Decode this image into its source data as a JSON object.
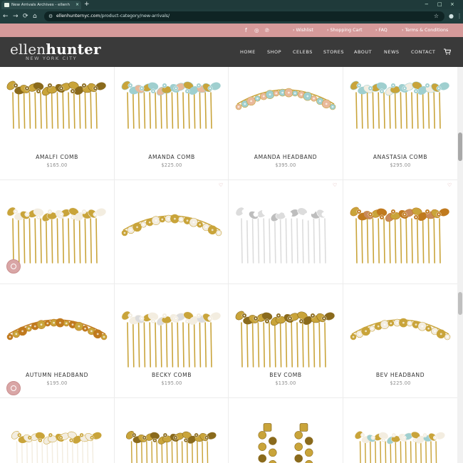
{
  "browser": {
    "tab_title": "New Arrivals Archives - ellenh",
    "tab_close": "×",
    "new_tab": "+",
    "url_domain": "ellenhunternyc.com",
    "url_path": "/product-category/new-arrivals/",
    "nav": {
      "back": "←",
      "forward": "→",
      "reload": "⟳",
      "home": "⌂"
    },
    "star": "☆",
    "account": "●",
    "menu": "⋮",
    "window_controls": {
      "minimize": "−",
      "maximize": "□",
      "close": "×"
    }
  },
  "topbar": {
    "social": {
      "facebook": "f",
      "instagram": "◎",
      "pinterest": "℗"
    },
    "links": [
      "› Wishlist",
      "› Shopping Cart",
      "› FAQ",
      "› Terms & Conditions"
    ]
  },
  "header": {
    "logo_light": "ellen",
    "logo_bold": "hunter",
    "logo_sub": "NEW YORK CITY",
    "nav": [
      "HOME",
      "SHOP",
      "CELEBS",
      "STORES",
      "ABOUT",
      "NEWS",
      "CONTACT"
    ]
  },
  "products": [
    {
      "name": "AMALFI COMB",
      "price": "$165.00",
      "type": "comb"
    },
    {
      "name": "AMANDA COMB",
      "price": "$225.00",
      "type": "comb"
    },
    {
      "name": "AMANDA HEADBAND",
      "price": "$395.00",
      "type": "headband"
    },
    {
      "name": "ANASTASIA COMB",
      "price": "$295.00",
      "type": "comb"
    },
    {
      "name": "",
      "price": "",
      "type": "comb"
    },
    {
      "name": "",
      "price": "",
      "type": "headband"
    },
    {
      "name": "",
      "price": "",
      "type": "comb"
    },
    {
      "name": "",
      "price": "",
      "type": "comb"
    },
    {
      "name": "AUTUMN HEADBAND",
      "price": "$195.00",
      "type": "headband"
    },
    {
      "name": "BECKY COMB",
      "price": "$195.00",
      "type": "comb"
    },
    {
      "name": "BEV COMB",
      "price": "$135.00",
      "type": "comb"
    },
    {
      "name": "BEV HEADBAND",
      "price": "$225.00",
      "type": "headband"
    },
    {
      "name": "",
      "price": "",
      "type": "comb"
    },
    {
      "name": "",
      "price": "",
      "type": "comb"
    },
    {
      "name": "",
      "price": "",
      "type": "earrings"
    },
    {
      "name": "",
      "price": "",
      "type": "comb"
    }
  ],
  "wishlist_icon": "♡",
  "colors": {
    "topbar": "#d59a9a",
    "header": "#3a3a3a",
    "gold": "#c9a43a",
    "gold_dark": "#8a6a1c",
    "pearl": "#f3ede0",
    "crystal": "#dcdcdc",
    "aqua": "#9fcfcf",
    "peach": "#e9b99a",
    "amber": "#c07a1e",
    "rose": "#c98a5a"
  }
}
